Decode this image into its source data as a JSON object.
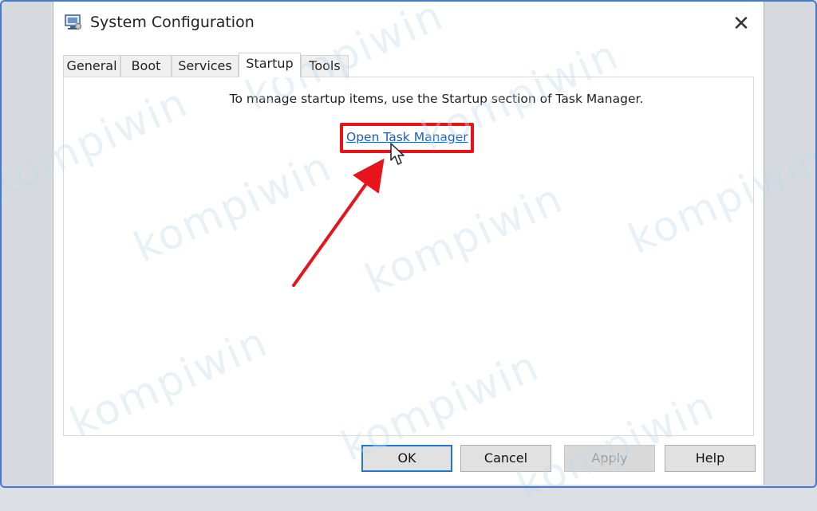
{
  "window": {
    "title": "System Configuration",
    "close_glyph": "✕"
  },
  "tabs": [
    {
      "label": "General"
    },
    {
      "label": "Boot"
    },
    {
      "label": "Services"
    },
    {
      "label": "Startup",
      "active": true
    },
    {
      "label": "Tools"
    }
  ],
  "startup": {
    "info_text": "To manage startup items, use the Startup section of Task Manager.",
    "link_label": "Open Task Manager"
  },
  "buttons": {
    "ok": "OK",
    "cancel": "Cancel",
    "apply": "Apply",
    "help": "Help"
  },
  "annotation": {
    "highlight_color": "#e8141b",
    "arrow_color": "#e8141b"
  },
  "watermark": {
    "text": "kompiwin",
    "color": "#c3dbe9"
  },
  "icons": {
    "app": "system-configuration-icon",
    "close": "close-icon",
    "pointer": "mouse-pointer-icon"
  }
}
